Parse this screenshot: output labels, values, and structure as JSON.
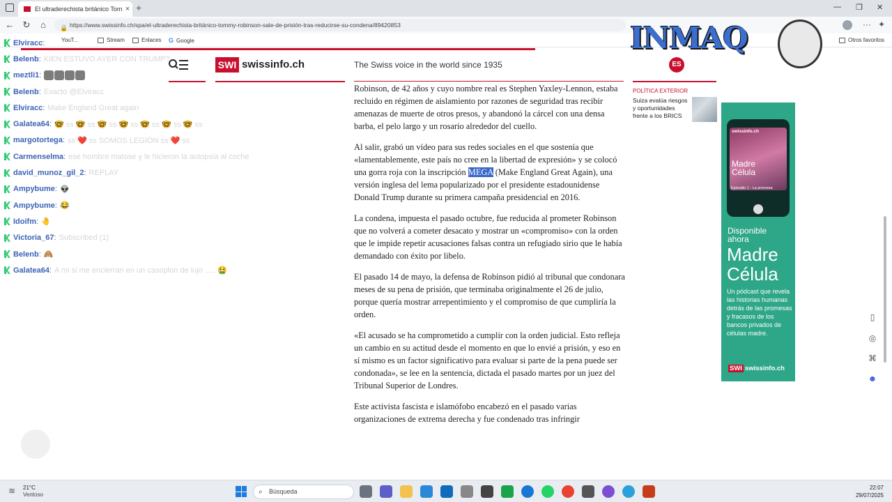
{
  "browser": {
    "tab_title": "El ultraderechista británico Tommy",
    "tab_close": "×",
    "new_tab": "+",
    "url": "https://www.swissinfo.ch/spa/el-ultraderechista-británico-tommy-robinson-sale-de-prisión-tras-reducirse-su-condena/89420853",
    "bookmarks": [
      "YouT...",
      "Stream",
      "Enlaces",
      "Google"
    ],
    "other_favorites": "Otros favoritos",
    "window_controls": [
      "—",
      "❐",
      "✕"
    ]
  },
  "site": {
    "logo_box": "SWI",
    "logo_text": "swissinfo.ch",
    "tagline": "The Swiss voice in the world since 1935",
    "language": "ES"
  },
  "article": {
    "paragraphs": [
      "Robinson, de 42 años y cuyo nombre real es Stephen Yaxley-Lennon, estaba recluido en régimen de aislamiento por razones de seguridad tras recibir amenazas de muerte de otros presos, y abandonó la cárcel con una densa barba, el pelo largo y un rosario alrededor del cuello.",
      "",
      "La condena, impuesta el pasado octubre, fue reducida al prometer Robinson que no volverá a cometer desacato y mostrar un «compromiso» con la orden que le impide repetir acusaciones falsas contra un refugiado sirio que le había demandado con éxito por libelo.",
      "El pasado 14 de mayo, la defensa de Robinson pidió al tribunal que condonara meses de su pena de prisión, que terminaba originalmente el 26 de julio, porque quería mostrar arrepentimiento y el compromiso de que cumpliría la orden.",
      "«El acusado se ha comprometido a cumplir con la orden judicial. Esto refleja un cambio en su actitud desde el momento en que lo envié a prisión, y eso en sí mismo es un factor significativo para evaluar si parte de la pena puede ser condonada», se lee en la sentencia, dictada el pasado martes por un juez del Tribunal Superior de Londres.",
      "Este activista fascista e islamófobo encabezó en el pasado varias organizaciones de extrema derecha y fue condenado tras infringir"
    ],
    "p2_before": "Al salir, grabó un vídeo para sus redes sociales en el que sostenía que «lamentablemente, este país no cree en la libertad de expresión» y se colocó una gorra roja con la inscripción ",
    "p2_highlight": "MEGA",
    "p2_after": " (Make England Great Again), una versión inglesa del lema popularizado por el presidente estadounidense Donald Trump durante su primera campaña presidencial en 2016."
  },
  "sidebar": {
    "category": "POLÍTICA EXTERIOR",
    "headline": "Suiza evalúa riesgos y oportunidades frente a los BRICS"
  },
  "ad": {
    "phone_logo": "swissinfo.ch",
    "phone_title": "Madre Célula",
    "phone_episode": "Episodio 1 - La promesa",
    "available": "Disponible ahora",
    "title": "Madre Célula",
    "description": "Un pódcast que revela las historias humanas detrás de las promesas y fracasos de los bancos privados de células madre.",
    "brand_box": "SWI",
    "brand_text": "swissinfo.ch",
    "color": "#2ea688"
  },
  "chat": [
    {
      "user": "Elviracc",
      "msg": ""
    },
    {
      "user": "Belenb",
      "msg": "KIEN ESTUVO AYER CON TRUMP?"
    },
    {
      "user": "meztli1",
      "msg": "",
      "emotes": 4
    },
    {
      "user": "Belenb",
      "msg": "Exacto @Elviracc"
    },
    {
      "user": "Elviracc",
      "msg": "Make England Great again"
    },
    {
      "user": "Galatea64",
      "msg": "🤓 ss 🤓 ss 🤓 ss 🤓 ss 🤓 ss 🤓 ss 🤓 ss"
    },
    {
      "user": "margotortega",
      "msg": "ss ❤️ ss SOMOS LEGIÓN ss ❤️ ss"
    },
    {
      "user": "Carmenselma",
      "msg": "ese hombre matose y le hicieron la autopsia al coche"
    },
    {
      "user": "david_munoz_gil_2",
      "msg": "REPLAY"
    },
    {
      "user": "Ampybume",
      "msg": "👽"
    },
    {
      "user": "Ampybume",
      "msg": "😂"
    },
    {
      "user": "Idoifm",
      "msg": "🤚"
    },
    {
      "user": "Victoria_67",
      "msg": "Subscribed (1)"
    },
    {
      "user": "Belenb",
      "msg": "🙈"
    },
    {
      "user": "Galatea64",
      "msg": "A mi si me encierran en un casoplon de lujo ..... 🤮"
    }
  ],
  "overlay": {
    "logo_text": "INMAQ"
  },
  "taskbar": {
    "temp": "21°C",
    "condition": "Ventoso",
    "search": "Búsqueda",
    "time": "22:07",
    "date": "29/07/2025"
  },
  "colors": {
    "brand_red": "#c8102e",
    "chat_user": "#3c63b5",
    "taskbar": "#e9edf2"
  }
}
